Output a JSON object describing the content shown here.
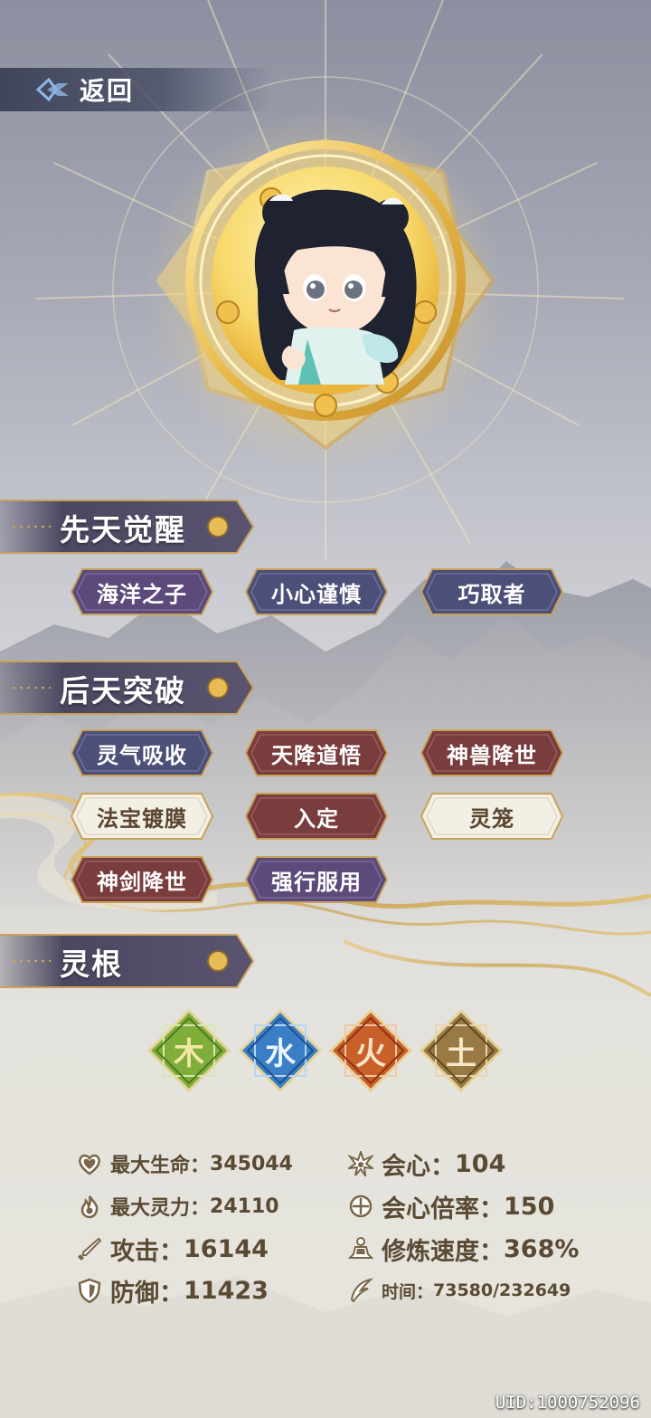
{
  "header": {
    "back_label": "返回"
  },
  "sections": {
    "innate": {
      "title": "先天觉醒"
    },
    "acquired": {
      "title": "后天突破"
    },
    "spirit_root": {
      "title": "灵根"
    }
  },
  "innate_tags": [
    {
      "label": "海洋之子",
      "style": "purple"
    },
    {
      "label": "小心谨慎",
      "style": "blue"
    },
    {
      "label": "巧取者",
      "style": "blue"
    }
  ],
  "acquired_tags": [
    {
      "label": "灵气吸收",
      "style": "blue"
    },
    {
      "label": "天降道悟",
      "style": "red"
    },
    {
      "label": "神兽降世",
      "style": "red"
    },
    {
      "label": "法宝镀膜",
      "style": "light"
    },
    {
      "label": "入定",
      "style": "red"
    },
    {
      "label": "灵笼",
      "style": "light"
    },
    {
      "label": "神剑降世",
      "style": "red"
    },
    {
      "label": "强行服用",
      "style": "purple"
    }
  ],
  "elements": [
    {
      "char": "木",
      "color": "#7fae3a",
      "icon": "wood-element-icon"
    },
    {
      "char": "水",
      "color": "#3a7fc6",
      "icon": "water-element-icon"
    },
    {
      "char": "火",
      "color": "#c9602a",
      "icon": "fire-element-icon"
    },
    {
      "char": "土",
      "color": "#9a7a44",
      "icon": "earth-element-icon"
    }
  ],
  "stats": {
    "max_hp": {
      "label": "最大生命：",
      "value": "345044",
      "icon": "heart-icon"
    },
    "max_spirit": {
      "label": "最大灵力：",
      "value": "24110",
      "icon": "flame-icon"
    },
    "attack": {
      "label": "攻击：",
      "value": "16144",
      "icon": "sword-icon"
    },
    "defense": {
      "label": "防御：",
      "value": "11423",
      "icon": "shield-icon"
    },
    "crit": {
      "label": "会心：",
      "value": "104",
      "icon": "burst-icon"
    },
    "crit_rate": {
      "label": "会心倍率：",
      "value": "150",
      "icon": "target-icon"
    },
    "cultivation_speed": {
      "label": "修炼速度：",
      "value": "368%",
      "icon": "meditation-icon"
    },
    "time": {
      "label": "时间：",
      "value": "73580/232649",
      "icon": "feather-icon"
    }
  },
  "uid": "UID:1000752096",
  "colors": {
    "tag_purple": "#5b4a7a",
    "tag_blue": "#4c4f78",
    "tag_red": "#7a3d3d",
    "tag_light": "#f2efe4",
    "gold": "#c9a25a",
    "stat_text": "#5a4a34"
  }
}
